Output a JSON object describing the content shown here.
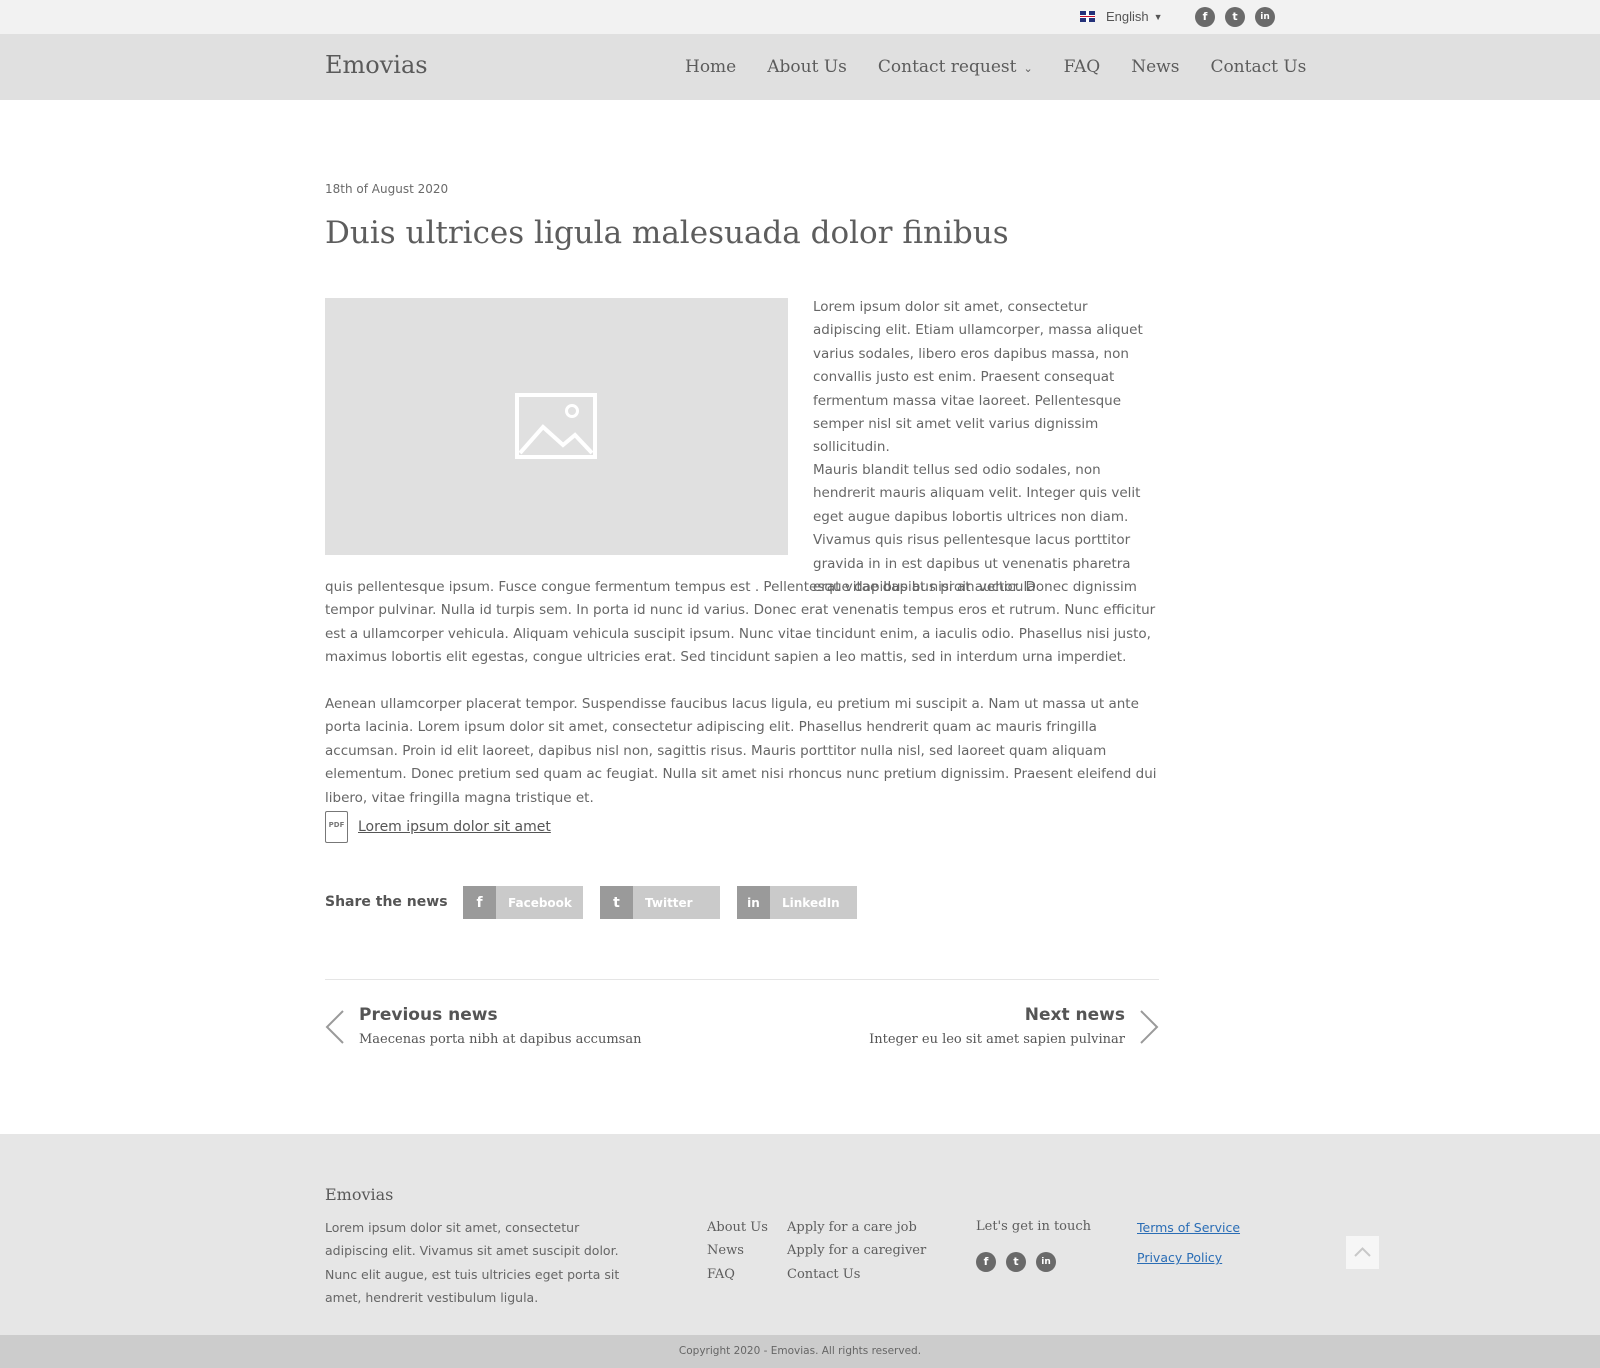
{
  "topbar": {
    "language": "English",
    "social": [
      {
        "icon": "facebook-icon",
        "glyph": "f"
      },
      {
        "icon": "twitter-icon",
        "glyph": "t"
      },
      {
        "icon": "linkedin-icon",
        "glyph": "in"
      }
    ]
  },
  "header": {
    "logo": "Emovias",
    "nav": [
      {
        "label": "Home"
      },
      {
        "label": "About Us"
      },
      {
        "label": "Contact request"
      },
      {
        "label": "FAQ"
      },
      {
        "label": "News"
      },
      {
        "label": "Contact Us"
      }
    ]
  },
  "article": {
    "date": "18th of August 2020",
    "title": "Duis ultrices ligula malesuada dolor finibus",
    "p1": " Lorem ipsum dolor sit amet, consectetur adipiscing elit. Etiam ullamcorper, massa aliquet varius sodales, libero eros dapibus massa, non convallis justo est enim. Praesent consequat fermentum massa vitae laoreet. Pellentesque semper nisl sit amet velit varius dignissim sollicitudin.",
    "p2": " Mauris blandit tellus sed odio sodales, non hendrerit mauris aliquam velit. Integer quis velit eget augue dapibus lobortis ultrices non diam. Vivamus quis risus pellentesque lacus porttitor gravida in in est dapibus ut venenatis pharetra erat vitae dapibus  proin vehicula",
    "p3": "quis pellentesque ipsum. Fusce congue fermentum tempus est . Pellentesque dapibus at nisi at auctor. Donec dignissim tempor pulvinar. Nulla id turpis sem. In porta id nunc id varius. Donec erat venenatis tempus eros et rutrum. Nunc efficitur est a ullamcorper vehicula. Aliquam vehicula suscipit ipsum. Nunc vitae tincidunt enim, a iaculis odio. Phasellus nisi justo, maximus lobortis elit egestas, congue ultricies erat. Sed tincidunt sapien a leo mattis, sed in interdum urna imperdiet.",
    "p4": "Aenean ullamcorper placerat tempor. Suspendisse faucibus lacus ligula, eu pretium mi suscipit a. Nam ut massa ut ante porta lacinia. Lorem ipsum dolor sit amet, consectetur adipiscing elit. Phasellus hendrerit quam ac mauris fringilla accumsan. Proin id elit laoreet, dapibus nisl non, sagittis risus. Mauris porttitor nulla nisl, sed laoreet quam aliquam elementum. Donec pretium sed quam ac feugiat. Nulla sit amet nisi rhoncus nunc pretium dignissim. Praesent eleifend dui libero, vitae fringilla magna tristique et.",
    "pdf_badge": "PDF",
    "pdf_link": "Lorem ipsum dolor sit amet"
  },
  "share": {
    "label": "Share the news",
    "buttons": [
      {
        "label": "Facebook",
        "icon": "facebook-icon",
        "glyph": "f"
      },
      {
        "label": "Twitter",
        "icon": "twitter-icon",
        "glyph": "t"
      },
      {
        "label": "LinkedIn",
        "icon": "linkedin-icon",
        "glyph": "in"
      }
    ]
  },
  "pager": {
    "prev_title": "Previous news",
    "prev_sub": "Maecenas porta nibh at dapibus accumsan",
    "next_title": "Next news",
    "next_sub": "Integer eu leo sit amet sapien pulvinar"
  },
  "footer": {
    "logo": "Emovias",
    "desc": "Lorem ipsum dolor sit amet, consectetur adipiscing elit. Vivamus sit amet suscipit dolor. Nunc elit augue, est tuis ultricies eget porta sit amet, hendrerit vestibulum ligula.",
    "col1": [
      "About Us",
      "News",
      "FAQ"
    ],
    "col2": [
      "Apply for a care job",
      "Apply for a caregiver",
      "Contact Us"
    ],
    "touch": "Let's get in touch",
    "terms": "Terms of Service",
    "privacy": "Privacy Policy",
    "copyright": "Copyright 2020 -  Emovias. All rights reserved."
  },
  "colors": {
    "link": "#2a6db5",
    "header_bg": "#e0e0e0",
    "footer_bg": "#e6e6e6"
  }
}
